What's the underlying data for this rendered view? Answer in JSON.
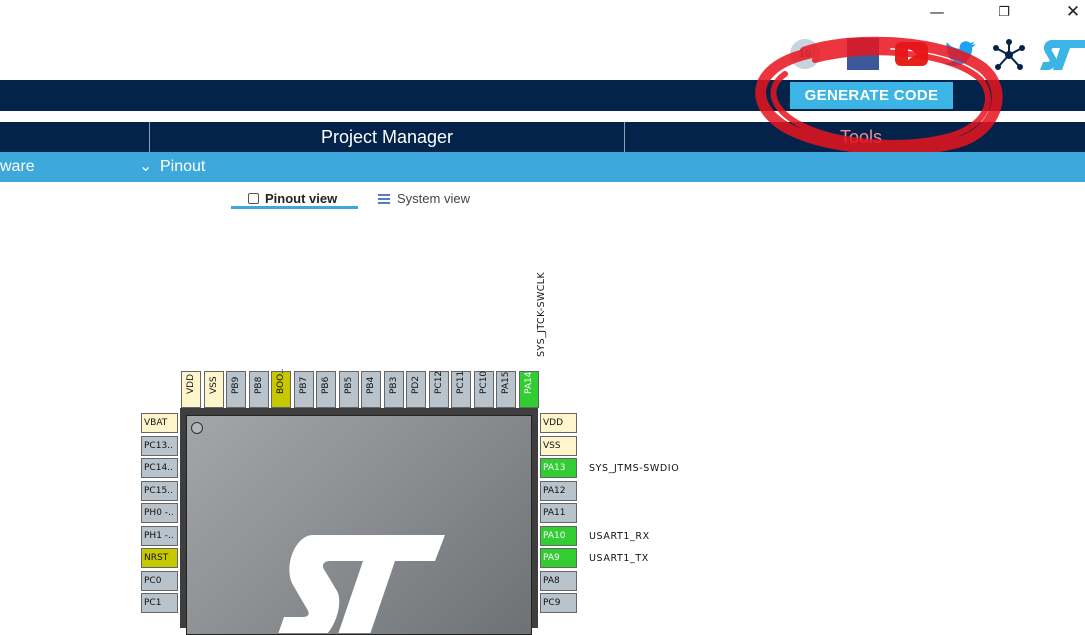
{
  "window": {
    "minimize_icon": "minimize-icon",
    "restore_icon": "restore-icon",
    "close_icon": "close-icon"
  },
  "social": [
    "anniversary-10-icon",
    "facebook-icon",
    "youtube-icon",
    "twitter-icon",
    "network-icon",
    "st-logo"
  ],
  "toolbar": {
    "generate_label": "GENERATE CODE"
  },
  "tabs": {
    "project_manager": "Project Manager",
    "tools": "Tools"
  },
  "subbar": {
    "left_partial": "ware",
    "pinout_label": "Pinout"
  },
  "views": {
    "pinout_view": "Pinout view",
    "system_view": "System view"
  },
  "top_signal": "SYS_JTCK-SWCLK",
  "top_pins": [
    "VDD",
    "VSS",
    "PB9",
    "PB8",
    "BOO..",
    "PB7",
    "PB6",
    "PB5",
    "PB4",
    "PB3",
    "PD2",
    "PC12",
    "PC11",
    "PC10",
    "PA15",
    "PA14"
  ],
  "left_pins": [
    "VBAT",
    "PC13..",
    "PC14..",
    "PC15..",
    "PH0 -..",
    "PH1 -..",
    "NRST",
    "PC0",
    "PC1"
  ],
  "right_pins": [
    "VDD",
    "VSS",
    "PA13",
    "PA12",
    "PA11",
    "PA10",
    "PA9",
    "PA8",
    "PC9"
  ],
  "right_signals": {
    "pa13": "SYS_JTMS-SWDIO",
    "pa10": "USART1_RX",
    "pa9": "USART1_TX"
  },
  "colors": {
    "navy": "#03234b",
    "accent": "#3cb4e6",
    "subbar": "#3ca8dc",
    "pin_green": "#32cd32",
    "pin_power": "#fff5cc",
    "pin_olive": "#c8c800",
    "annotation": "#e8141e"
  }
}
